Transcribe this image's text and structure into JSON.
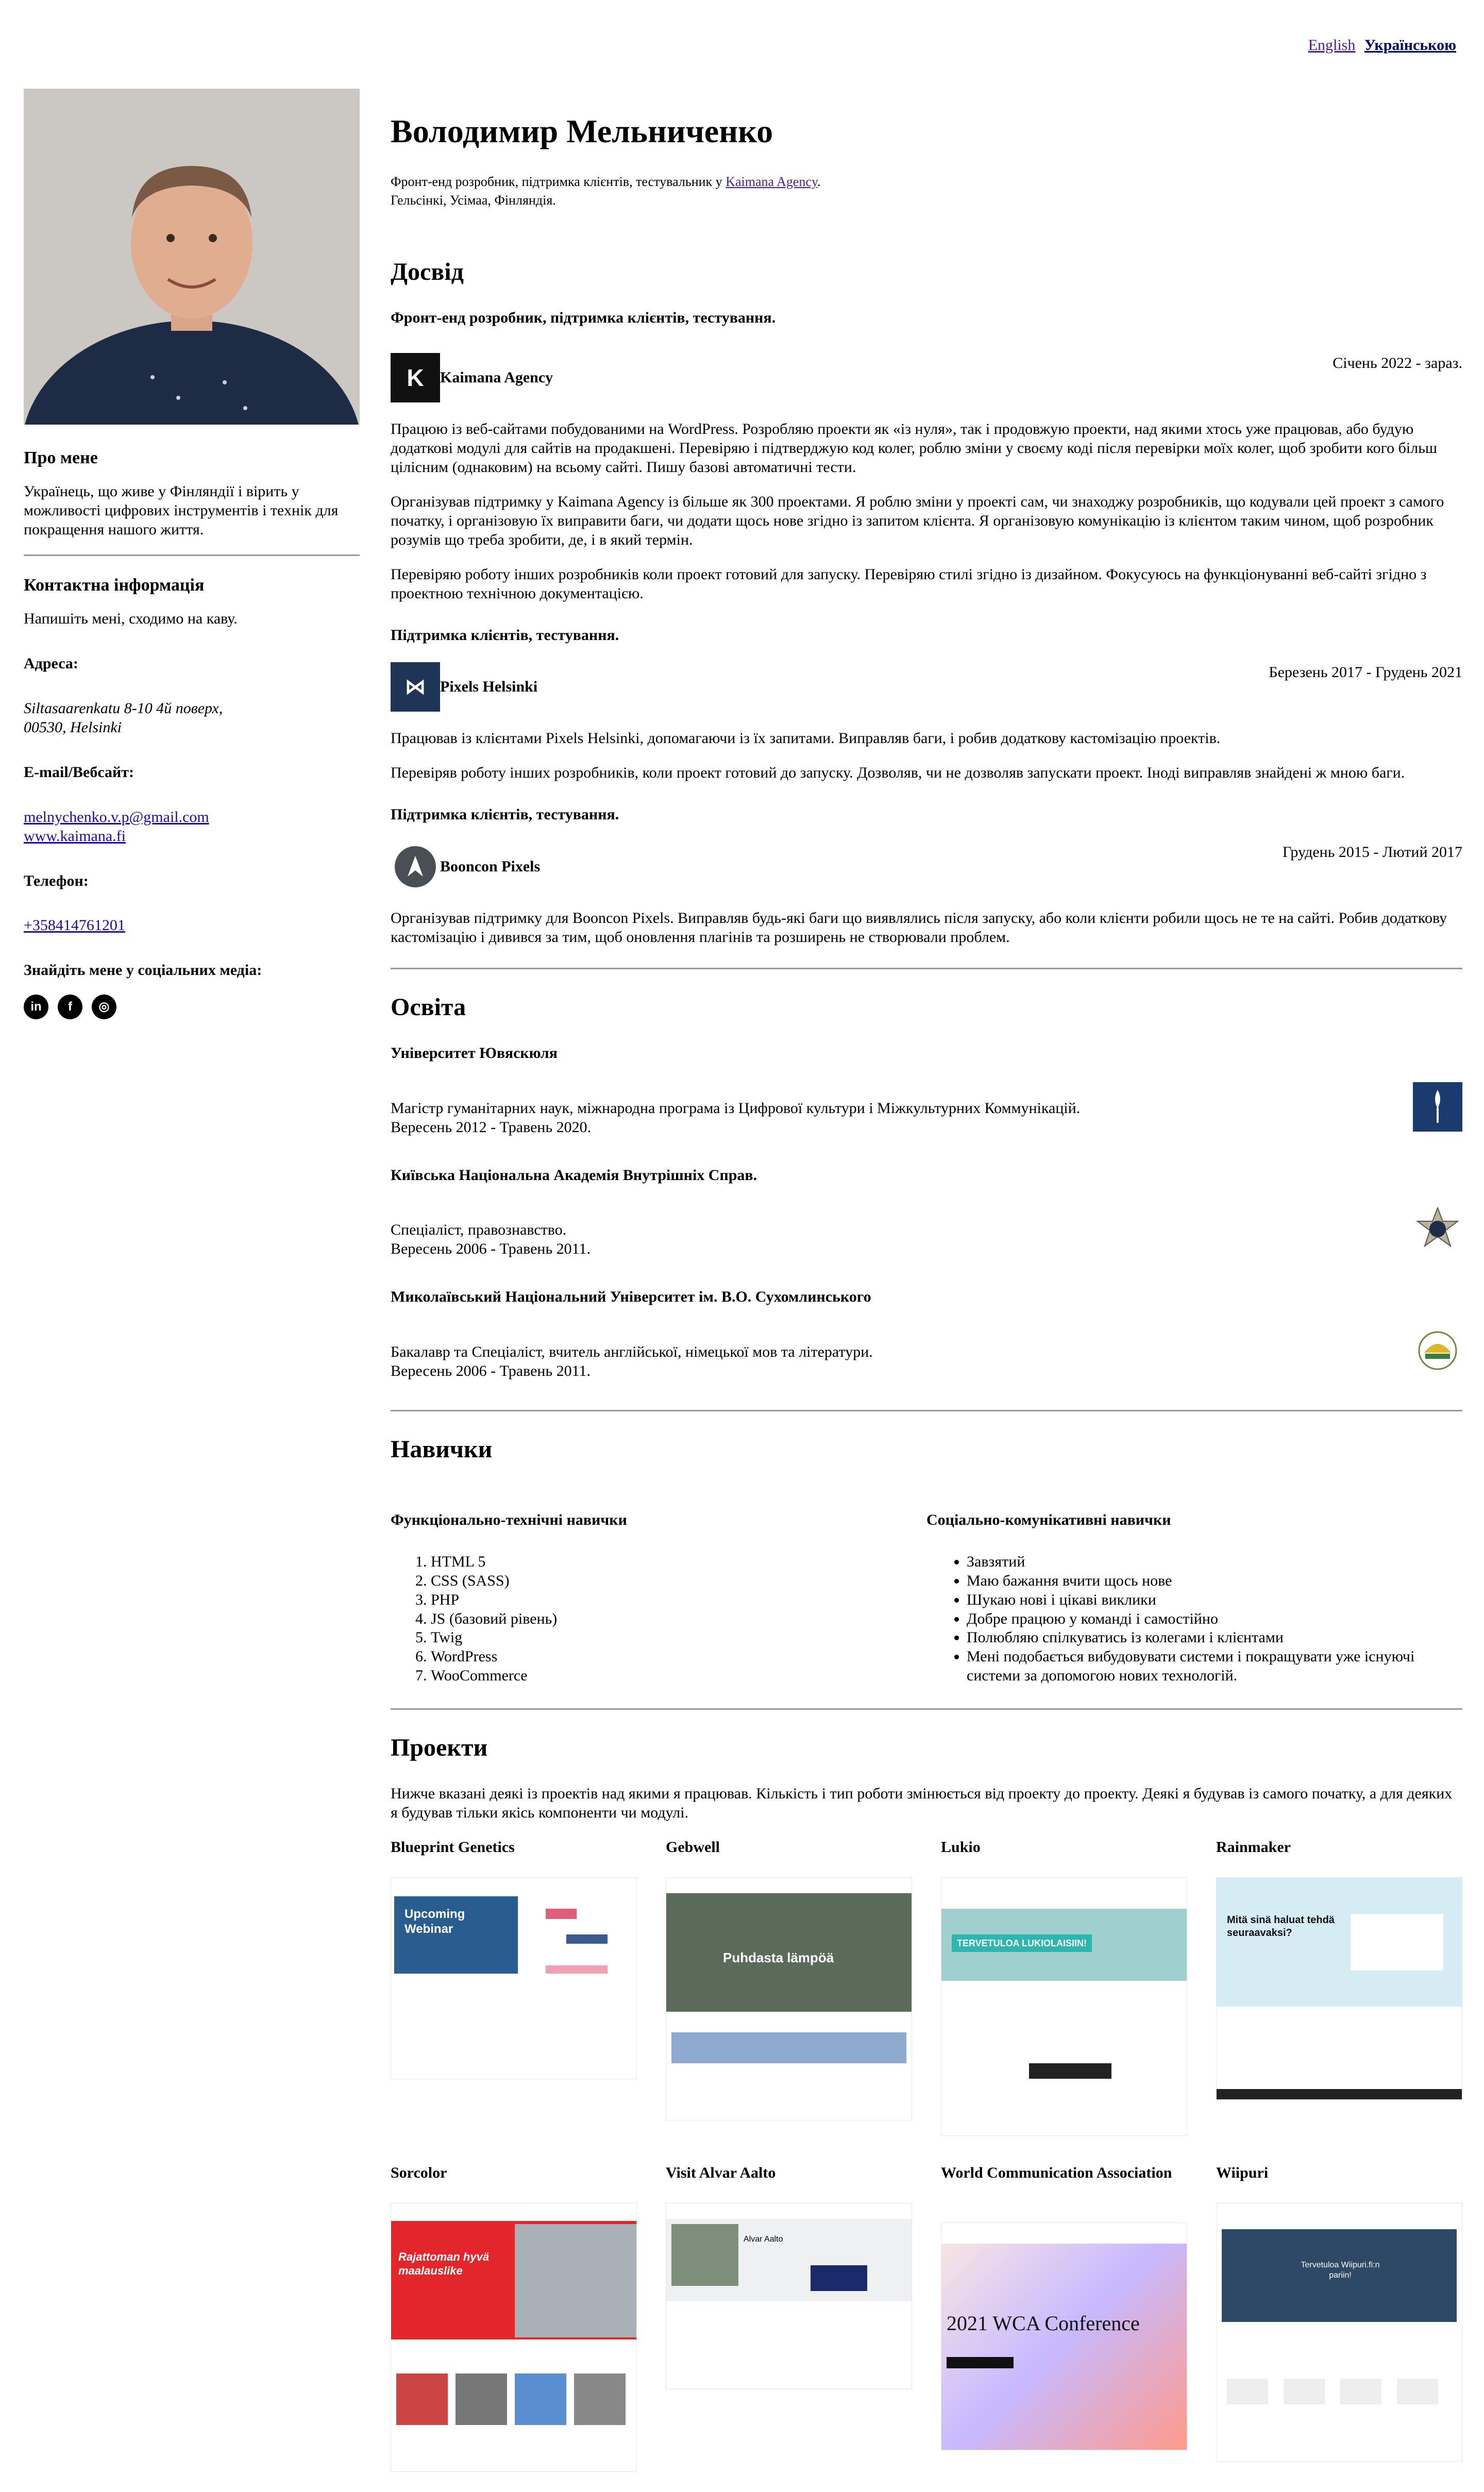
{
  "lang": {
    "en": "English",
    "uk": "Українською"
  },
  "sidebar": {
    "about_title": "Про мене",
    "about_text": "Українець, що живе у Фінляндії і вірить у можливості цифрових інструментів і технік для покращення нашого життя.",
    "contact_title": "Контактна інформація",
    "contact_text": "Напишіть мені, сходимо на каву.",
    "address_label": "Адреса:",
    "address_line1": "Siltasaarenkatu 8-10 4й поверх,",
    "address_line2": "00530, Helsinki",
    "email_label": "E-mail/Вебсайт:",
    "email": "melnychenko.v.p@gmail.com",
    "website": "www.kaimana.fi",
    "phone_label": "Телефон:",
    "phone": "+358414761201",
    "social_label": "Знайдіть мене у соціальних медіа:",
    "social": [
      "in",
      "f",
      "◎"
    ]
  },
  "header": {
    "name": "Володимир Мельниченко",
    "subtitle_pre": "Фронт-енд розробник, підтримка клієнтів, тестувальник у ",
    "subtitle_link": "Kaimana Agency",
    "subtitle_post": ".",
    "location": "Гельсінкі, Усімаа, Фінляндія."
  },
  "experience": {
    "title": "Досвід",
    "jobs": [
      {
        "role": "Фронт-енд розробник, підтримка клієнтів, тестування.",
        "company": "Kaimana Agency",
        "dates": "Січень 2022 - зараз.",
        "paragraphs": [
          "Працюю із веб-сайтами побудованими на WordPress. Розробляю проекти як «із нуля», так і продовжую проекти, над якими хтось уже працював, або будую додаткові модулі для сайтів на продакшені. Перевіряю і підтверджую код колег, роблю зміни у своєму коді після перевірки моїх колег, щоб зробити кого більш цілісним (однаковим) на всьому сайті. Пишу базові автоматичні тести.",
          "Організував підтримку у Kaimana Agency із більше як 300 проектами. Я роблю зміни у проекті сам, чи знаходжу розробників, що кодували цей проект з самого початку, і організовую їх виправити баги, чи додати щось нове згідно із запитом клієнта. Я організовую комунікацію із клієнтом таким чином, щоб розробник розумів що треба зробити, де, і в який термін.",
          "Перевіряю роботу інших розробників коли проект готовий для запуску. Перевіряю стилі згідно із дизайном. Фокусуюсь на функціонуванні веб-сайті згідно з проектною технічною документацією."
        ]
      },
      {
        "role": "Підтримка клієнтів, тестування.",
        "company": "Pixels Helsinki",
        "dates": "Березень 2017 - Грудень 2021",
        "paragraphs": [
          "Працював із клієнтами Pixels Helsinki, допомагаючи із їх запитами. Виправляв баги, і робив додаткову кастомізацію проектів.",
          "Перевіряв роботу інших розробників, коли проект готовий до запуску. Дозволяв, чи не дозволяв запускати проект. Іноді виправляв знайдені ж мною баги."
        ]
      },
      {
        "role": "Підтримка клієнтів, тестування.",
        "company": "Booncon Pixels",
        "dates": "Грудень 2015 - Лютий 2017",
        "paragraphs": [
          "Організував підтримку для Booncon Pixels. Виправляв будь-які баги що виявлялись після запуску, або коли клієнти робили щось не те на сайті. Робив додаткову кастомізацію і дивився за тим, щоб оновлення плагінів та розширень не створювали проблем."
        ]
      }
    ]
  },
  "education": {
    "title": "Освіта",
    "items": [
      {
        "name": "Університет Ювяскюля",
        "degree": "Магістр гуманітарних наук, міжнародна програма із Цифрової культури і Міжкультурних Коммунікацій.",
        "dates": "Вересень 2012 - Травень 2020."
      },
      {
        "name": "Київська Національна Академія Внутрішніх Справ.",
        "degree": "Спеціаліст, правознавство.",
        "dates": "Вересень 2006 - Травень 2011."
      },
      {
        "name": "Миколаївський Національний Університет ім. В.О. Сухомлинського",
        "degree": "Бакалавр та Спеціаліст, вчитель англійської, німецької мов та літератури.",
        "dates": "Вересень 2006 - Травень 2011."
      }
    ]
  },
  "skills": {
    "title": "Навички",
    "tech_title": "Функціонально-технічні навички",
    "tech": [
      "HTML 5",
      "CSS (SASS)",
      "PHP",
      "JS (базовий рівень)",
      "Twig",
      "WordPress",
      "WooCommerce"
    ],
    "soft_title": "Соціально-комунікативні навички",
    "soft": [
      "Завзятий",
      "Маю бажання вчити щось нове",
      "Шукаю нові і цікаві виклики",
      "Добре працюю у команді і самостійно",
      "Полюбляю спілкуватись із колегами і клієнтами",
      "Мені подобається вибудовувати системи і покращувати уже існуючі системи за допомогою нових технологій."
    ]
  },
  "projects": {
    "title": "Проекти",
    "intro": "Нижче вказані деякі із проектів над якими я працював. Кількість і тип роботи змінюється від проекту до проекту. Деякі я будував із самого початку, а для деяких я будував тільки якісь компоненти чи модулі.",
    "items": [
      {
        "name": "Blueprint Genetics",
        "shot_text": "Upcoming Webinar"
      },
      {
        "name": "Gebwell",
        "shot_text": "Puhdasta lämpöä"
      },
      {
        "name": "Lukio",
        "shot_text": "TERVETULOA LUKIOLAISIIN!"
      },
      {
        "name": "Rainmaker",
        "shot_text": "Mitä sinä haluat tehdä seuraavaksi?"
      },
      {
        "name": "Sorcolor",
        "shot_text": "Rajattoman hyvä maalauslike"
      },
      {
        "name": "Visit Alvar Aalto",
        "shot_text": "Alvar Aalto"
      },
      {
        "name": "World Communication Association",
        "shot_text": "2021 WCA Conference"
      },
      {
        "name": "Wiipuri",
        "shot_text": "Tervetuloa Wiipuri.fi:n pariin!"
      }
    ]
  },
  "colors": {
    "kaimana": "#111111",
    "pixels": "#1e3557",
    "booncon": "#4a4f55",
    "jyu": "#1b3b6f"
  }
}
